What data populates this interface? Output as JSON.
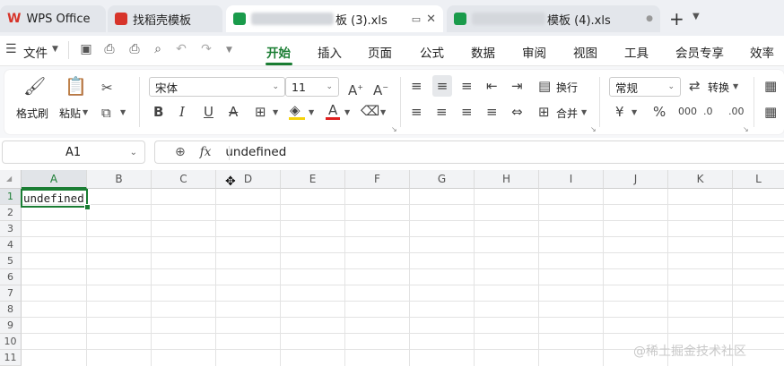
{
  "tabs": [
    {
      "label": "WPS Office",
      "state": "inactive"
    },
    {
      "label": "找稻壳模板",
      "state": "inactive"
    },
    {
      "label": "板 (3).xls",
      "state": "active"
    },
    {
      "label": "模板 (4).xls",
      "state": "inactive"
    }
  ],
  "menu": {
    "file": "文件",
    "items": [
      "开始",
      "插入",
      "页面",
      "公式",
      "数据",
      "审阅",
      "视图",
      "工具",
      "会员专享",
      "效率"
    ],
    "active": "开始"
  },
  "ribbon": {
    "format_painter": "格式刷",
    "paste": "粘贴",
    "font_name": "宋体",
    "font_size": "11",
    "number_format": "常规",
    "convert": "转换",
    "wrap": "换行",
    "merge": "合并",
    "currency": "¥",
    "percent": "%"
  },
  "formula_bar": {
    "name_box": "A1",
    "fx": "fx",
    "content": "undefined"
  },
  "grid": {
    "columns": [
      "A",
      "B",
      "C",
      "D",
      "E",
      "F",
      "G",
      "H",
      "I",
      "J",
      "K",
      "L"
    ],
    "rows": [
      "1",
      "2",
      "3",
      "4",
      "5",
      "6",
      "7",
      "8",
      "9",
      "10",
      "11"
    ],
    "selected_column": "A",
    "selected_row": "1",
    "a1_value": "undefined"
  },
  "watermark": "@稀土掘金技术社区",
  "colors": {
    "accent": "#1a7d33",
    "wps_red": "#d7342a"
  }
}
